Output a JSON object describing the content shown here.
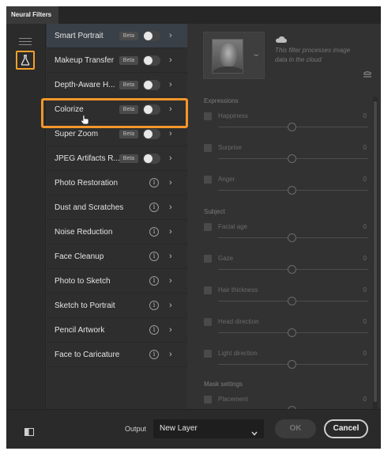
{
  "window": {
    "tab_title": "Neural Filters"
  },
  "filters": [
    {
      "name": "Smart Portrait",
      "beta": "Beta",
      "control": "toggle",
      "active": true
    },
    {
      "name": "Makeup Transfer",
      "beta": "Beta",
      "control": "toggle"
    },
    {
      "name": "Depth-Aware H...",
      "beta": "Beta",
      "control": "toggle"
    },
    {
      "name": "Colorize",
      "beta": "Beta",
      "control": "toggle",
      "highlighted": true
    },
    {
      "name": "Super Zoom",
      "beta": "Beta",
      "control": "toggle"
    },
    {
      "name": "JPEG Artifacts R...",
      "beta": "Beta",
      "control": "toggle"
    },
    {
      "name": "Photo Restoration",
      "control": "info"
    },
    {
      "name": "Dust and Scratches",
      "control": "info"
    },
    {
      "name": "Noise Reduction",
      "control": "info"
    },
    {
      "name": "Face Cleanup",
      "control": "info"
    },
    {
      "name": "Photo to Sketch",
      "control": "info"
    },
    {
      "name": "Sketch to Portrait",
      "control": "info"
    },
    {
      "name": "Pencil Artwork",
      "control": "info"
    },
    {
      "name": "Face to Caricature",
      "control": "info"
    }
  ],
  "icons": {
    "chevron": "›",
    "info": "i",
    "output_chevron": "chevron-down-icon"
  },
  "settings": {
    "cloud_note": "This filter processes image data in the cloud",
    "sections": {
      "expressions": "Expressions",
      "subject": "Subject",
      "mask": "Mask settings"
    },
    "params": {
      "happiness": {
        "label": "Happiness",
        "value": "0"
      },
      "surprise": {
        "label": "Surprise",
        "value": "0"
      },
      "anger": {
        "label": "Anger",
        "value": "0"
      },
      "facial_age": {
        "label": "Facial age",
        "value": "0"
      },
      "gaze": {
        "label": "Gaze",
        "value": "0"
      },
      "hair_thickness": {
        "label": "Hair thickness",
        "value": "0"
      },
      "head_direction": {
        "label": "Head direction",
        "value": "0"
      },
      "light_direction": {
        "label": "Light direction",
        "value": "0"
      },
      "placement": {
        "label": "Placement",
        "value": "0"
      }
    }
  },
  "footer": {
    "output_label": "Output",
    "output_value": "New Layer",
    "ok": "OK",
    "cancel": "Cancel"
  },
  "colors": {
    "highlight": "#f5962a",
    "background": "#323232"
  }
}
